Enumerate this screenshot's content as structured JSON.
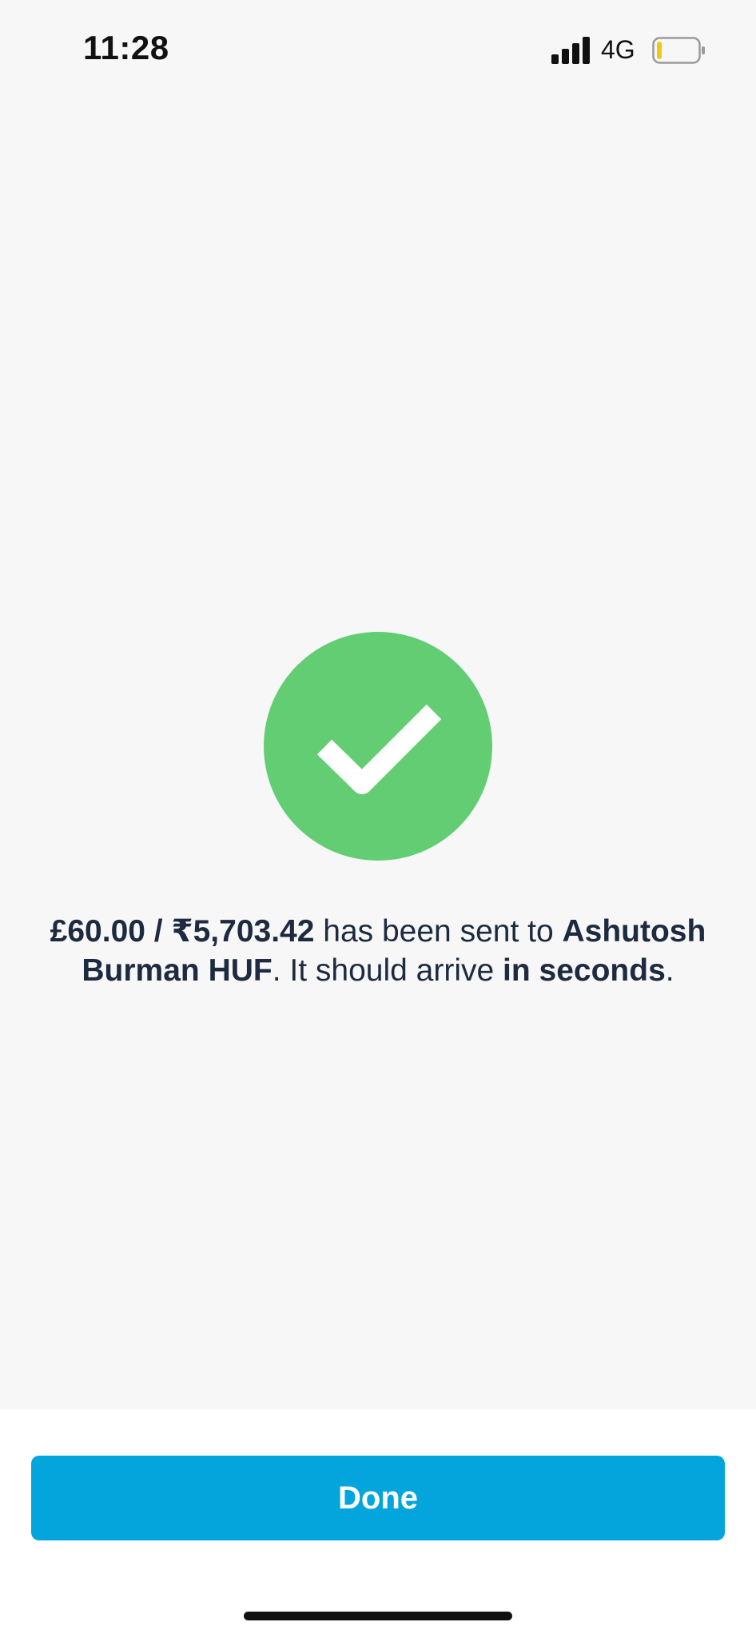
{
  "status_bar": {
    "time": "11:28",
    "network": "4G",
    "signal_icon": "cellular-signal-icon",
    "battery_icon": "battery-low-icon",
    "battery_level_fraction": 0.12,
    "battery_color": "#f5c518"
  },
  "success": {
    "icon": "checkmark-icon",
    "circle_color": "#63cd74",
    "amount": "£60.00 / ₹5,703.42",
    "sent_text": " has been sent to ",
    "recipient": "Ashutosh Burman HUF",
    "arrive_text": ". It should arrive ",
    "arrival_time": "in seconds",
    "end_text": "."
  },
  "actions": {
    "done_label": "Done",
    "button_color": "#03a5dc"
  }
}
